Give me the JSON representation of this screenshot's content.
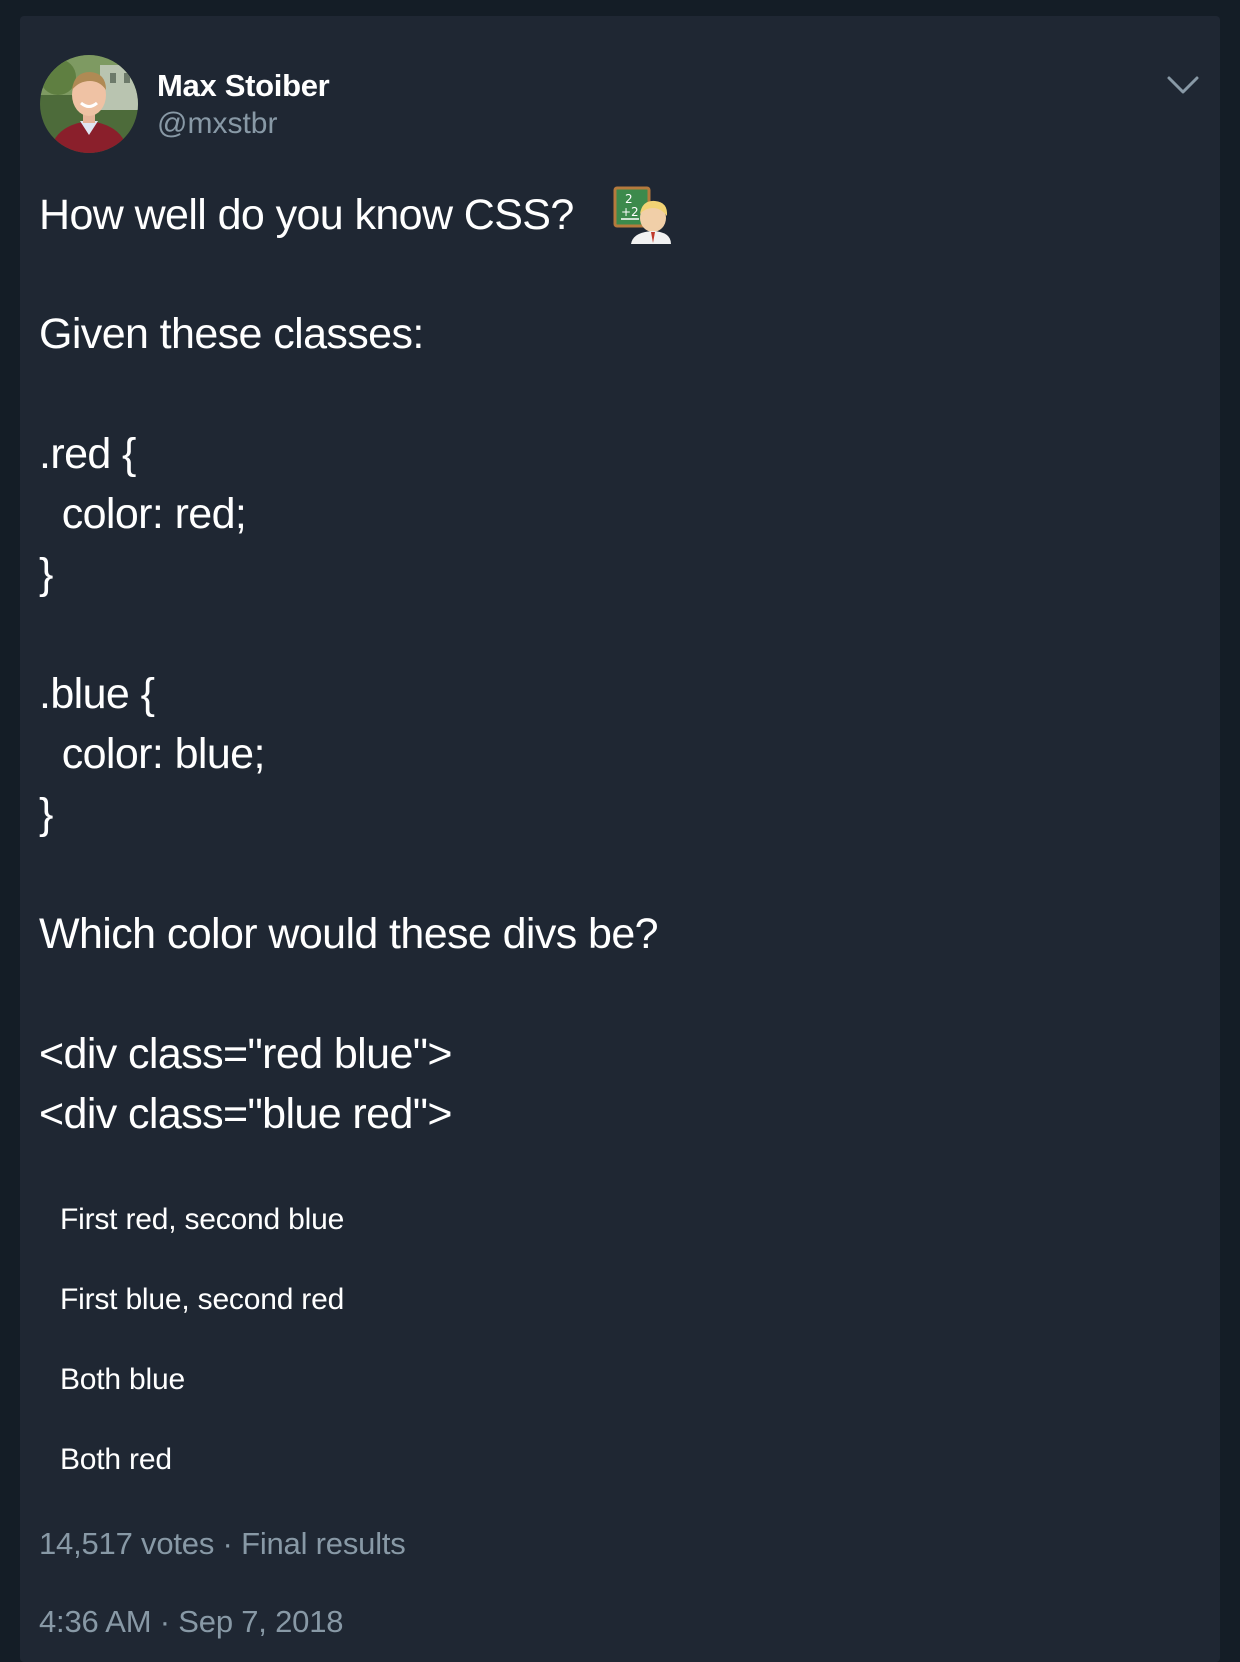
{
  "author": {
    "display_name": "Max Stoiber",
    "handle": "@mxstbr"
  },
  "icons": {
    "more": "chevron-down-icon",
    "emoji": "teacher-emoji-icon"
  },
  "tweet": {
    "lines": [
      "How well do you know CSS?",
      "Given these classes:",
      ".red {",
      "  color: red;",
      "}",
      ".blue {",
      "  color: blue;",
      "}",
      "Which color would these divs be?",
      "<div class=\"red blue\">",
      "<div class=\"blue red\">"
    ]
  },
  "poll": {
    "options": [
      "First red, second blue",
      "First blue, second red",
      "Both blue",
      "Both red"
    ],
    "votes_text": "14,517 votes",
    "status_text": "Final results"
  },
  "timestamp": {
    "time": "4:36 AM",
    "date": "Sep 7, 2018"
  },
  "colors": {
    "background": "#141d26",
    "card": "#1f2733",
    "text": "#ffffff",
    "secondary_text": "#8899a6"
  }
}
